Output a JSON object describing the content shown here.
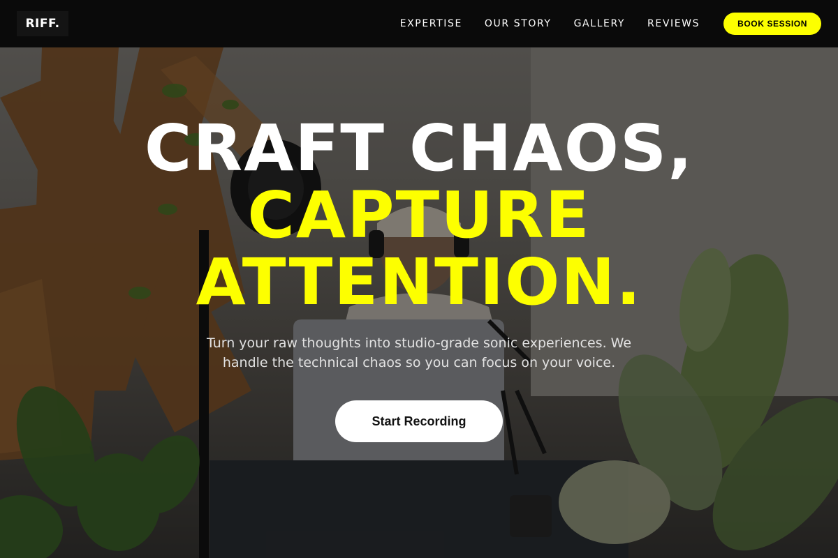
{
  "brand": {
    "logo_text": "RIFF."
  },
  "nav": {
    "items": [
      {
        "label": "EXPERTISE"
      },
      {
        "label": "OUR STORY"
      },
      {
        "label": "GALLERY"
      },
      {
        "label": "REVIEWS"
      }
    ],
    "cta_label": "BOOK SESSION"
  },
  "hero": {
    "headline_line1": "CRAFT CHAOS,",
    "headline_line2": "CAPTURE",
    "headline_line3": "ATTENTION.",
    "subtext": "Turn your raw thoughts into studio-grade sonic experiences. We handle the technical chaos so you can focus on your voice.",
    "cta_label": "Start Recording"
  },
  "colors": {
    "accent": "#fdff00",
    "navbar_bg": "#0a0a0a",
    "headline_white": "#ffffff",
    "button_white": "#ffffff"
  },
  "background_image": {
    "icon": "studio-photo"
  }
}
